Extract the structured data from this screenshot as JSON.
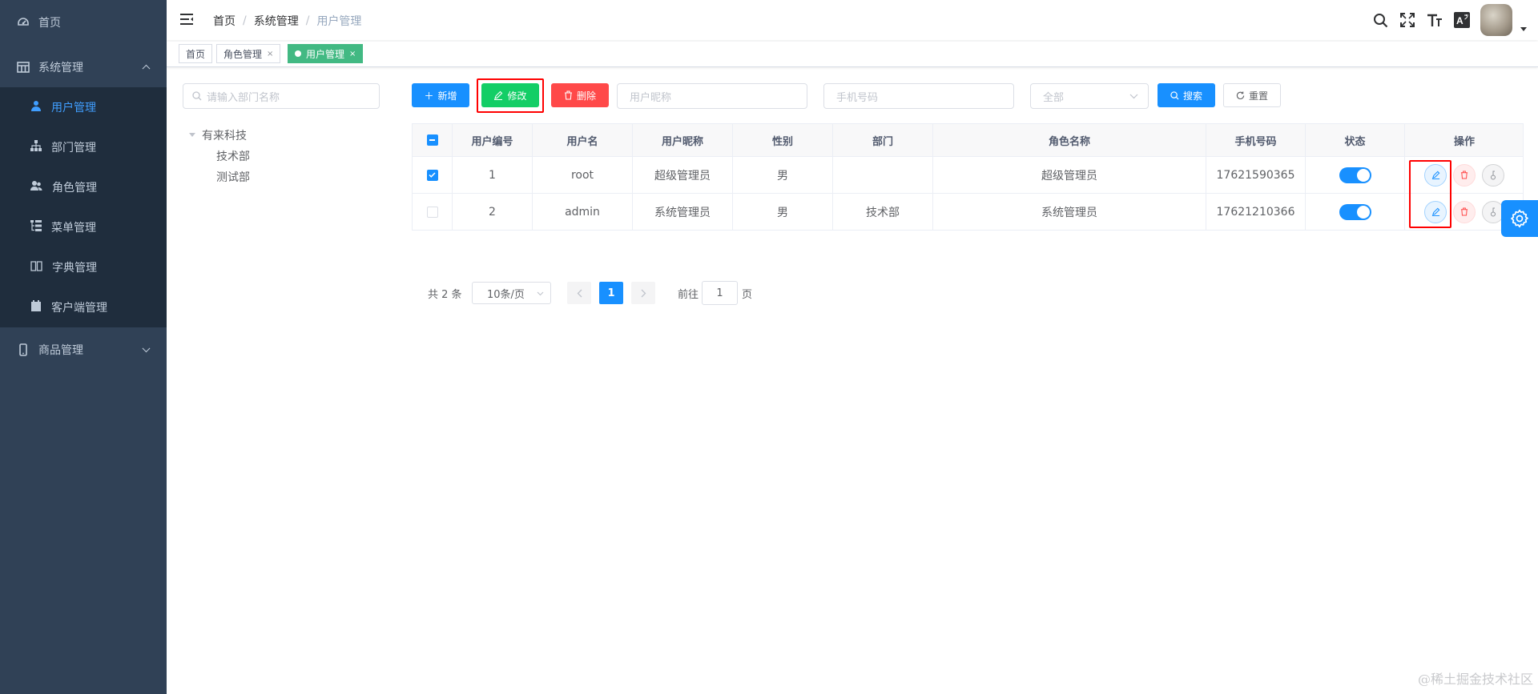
{
  "sidebar": {
    "items": [
      {
        "label": "首页",
        "icon": "dashboard-icon"
      },
      {
        "label": "系统管理",
        "icon": "system-grid-icon"
      },
      {
        "label": "商品管理",
        "icon": "mobile-icon"
      }
    ],
    "system_children": [
      {
        "label": "用户管理",
        "icon": "user-icon"
      },
      {
        "label": "部门管理",
        "icon": "tree-icon"
      },
      {
        "label": "角色管理",
        "icon": "peoples-icon"
      },
      {
        "label": "菜单管理",
        "icon": "tree-table-icon"
      },
      {
        "label": "字典管理",
        "icon": "dict-icon"
      },
      {
        "label": "客户端管理",
        "icon": "clipboard-icon"
      }
    ],
    "active_color": "#409eff"
  },
  "navbar": {
    "breadcrumb": [
      "首页",
      "系统管理",
      "用户管理"
    ],
    "breadcrumb_sep": "/",
    "icons": [
      "search-icon",
      "fullscreen-icon",
      "font-size-icon",
      "language-icon"
    ],
    "lang_badge": "A"
  },
  "tags": [
    {
      "label": "首页",
      "close": ""
    },
    {
      "label": "角色管理",
      "close": "×"
    },
    {
      "label": "用户管理",
      "close": "×"
    }
  ],
  "dept": {
    "search_placeholder": "请输入部门名称",
    "root": "有来科技",
    "children": [
      "技术部",
      "测试部"
    ]
  },
  "toolbar": {
    "add_label": "新增",
    "edit_label": "修改",
    "delete_label": "删除",
    "nickname_placeholder": "用户昵称",
    "mobile_placeholder": "手机号码",
    "status_value": "全部",
    "search_label": "搜索",
    "reset_label": "重置"
  },
  "table": {
    "columns": [
      "用户编号",
      "用户名",
      "用户昵称",
      "性别",
      "部门",
      "角色名称",
      "手机号码",
      "状态",
      "操作"
    ],
    "rows": [
      {
        "checked": true,
        "id": "1",
        "username": "root",
        "nickname": "超级管理员",
        "gender": "男",
        "dept": "",
        "role": "超级管理员",
        "mobile": "17621590365",
        "status": true
      },
      {
        "checked": false,
        "id": "2",
        "username": "admin",
        "nickname": "系统管理员",
        "gender": "男",
        "dept": "技术部",
        "role": "系统管理员",
        "mobile": "17621210366",
        "status": true
      }
    ]
  },
  "pagination": {
    "total": "共 2 条",
    "page_size": "10条/页",
    "current_page": "1",
    "goto_prefix": "前往",
    "goto_value": "1",
    "goto_suffix": "页"
  },
  "colors": {
    "primary": "#1890ff",
    "success": "#13ce66",
    "danger": "#ff4949",
    "tag_active": "#42b983",
    "sidebar_bg": "#304156",
    "submenu_bg": "#1f2d3d",
    "highlight_frame": "#ff0000"
  },
  "watermark": "@稀土掘金技术社区"
}
